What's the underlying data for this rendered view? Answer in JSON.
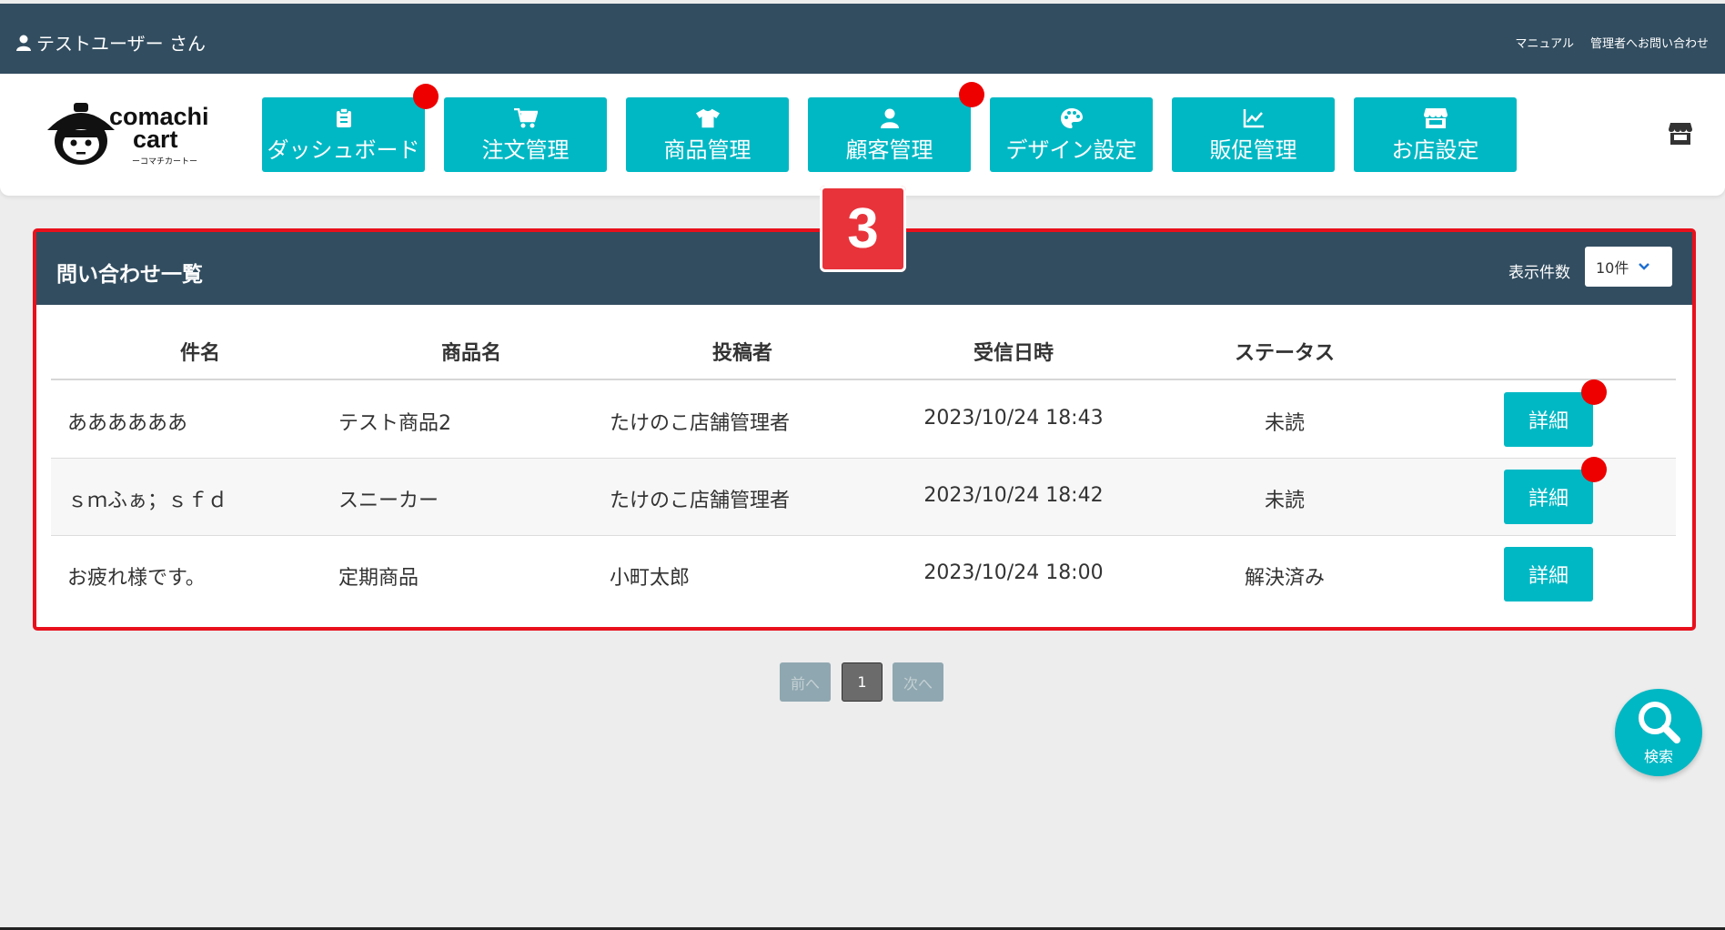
{
  "topbar": {
    "user_name": "テストユーザー さん",
    "manual_link": "マニュアル",
    "contact_link": "管理者へお問い合わせ"
  },
  "logo": {
    "line1": "comachi",
    "line2": "cart",
    "line3": "ーコマチカートー"
  },
  "nav": [
    {
      "label": "ダッシュボード",
      "icon": "clipboard-icon",
      "badge": true
    },
    {
      "label": "注文管理",
      "icon": "cart-icon",
      "badge": false
    },
    {
      "label": "商品管理",
      "icon": "tshirt-icon",
      "badge": false
    },
    {
      "label": "顧客管理",
      "icon": "user-icon",
      "badge": true
    },
    {
      "label": "デザイン設定",
      "icon": "palette-icon",
      "badge": false
    },
    {
      "label": "販促管理",
      "icon": "chart-line-icon",
      "badge": false
    },
    {
      "label": "お店設定",
      "icon": "store-icon",
      "badge": false
    }
  ],
  "marker": {
    "number": "3"
  },
  "panel": {
    "title": "問い合わせ一覧",
    "per_page_label": "表示件数",
    "per_page_value": "10件"
  },
  "table": {
    "headers": [
      "件名",
      "商品名",
      "投稿者",
      "受信日時",
      "ステータス"
    ],
    "rows": [
      {
        "subject": "ああああああ",
        "product": "テスト商品2",
        "poster": "たけのこ店舗管理者",
        "received": "2023/10/24 18:43",
        "status": "未読",
        "action": "詳細",
        "unread_dot": true
      },
      {
        "subject": "ｓｍふぁ；ｓｆｄ",
        "product": "スニーカー",
        "poster": "たけのこ店舗管理者",
        "received": "2023/10/24 18:42",
        "status": "未読",
        "action": "詳細",
        "unread_dot": true
      },
      {
        "subject": "お疲れ様です。",
        "product": "定期商品",
        "poster": "小町太郎",
        "received": "2023/10/24 18:00",
        "status": "解決済み",
        "action": "詳細",
        "unread_dot": false
      }
    ]
  },
  "pagination": {
    "prev": "前へ",
    "current": "1",
    "next": "次へ"
  },
  "search_fab": {
    "label": "検索"
  },
  "colors": {
    "nav_bg": "#324d60",
    "accent": "#00b8c4",
    "badge": "#ee0000",
    "highlight": "#e8101c"
  }
}
